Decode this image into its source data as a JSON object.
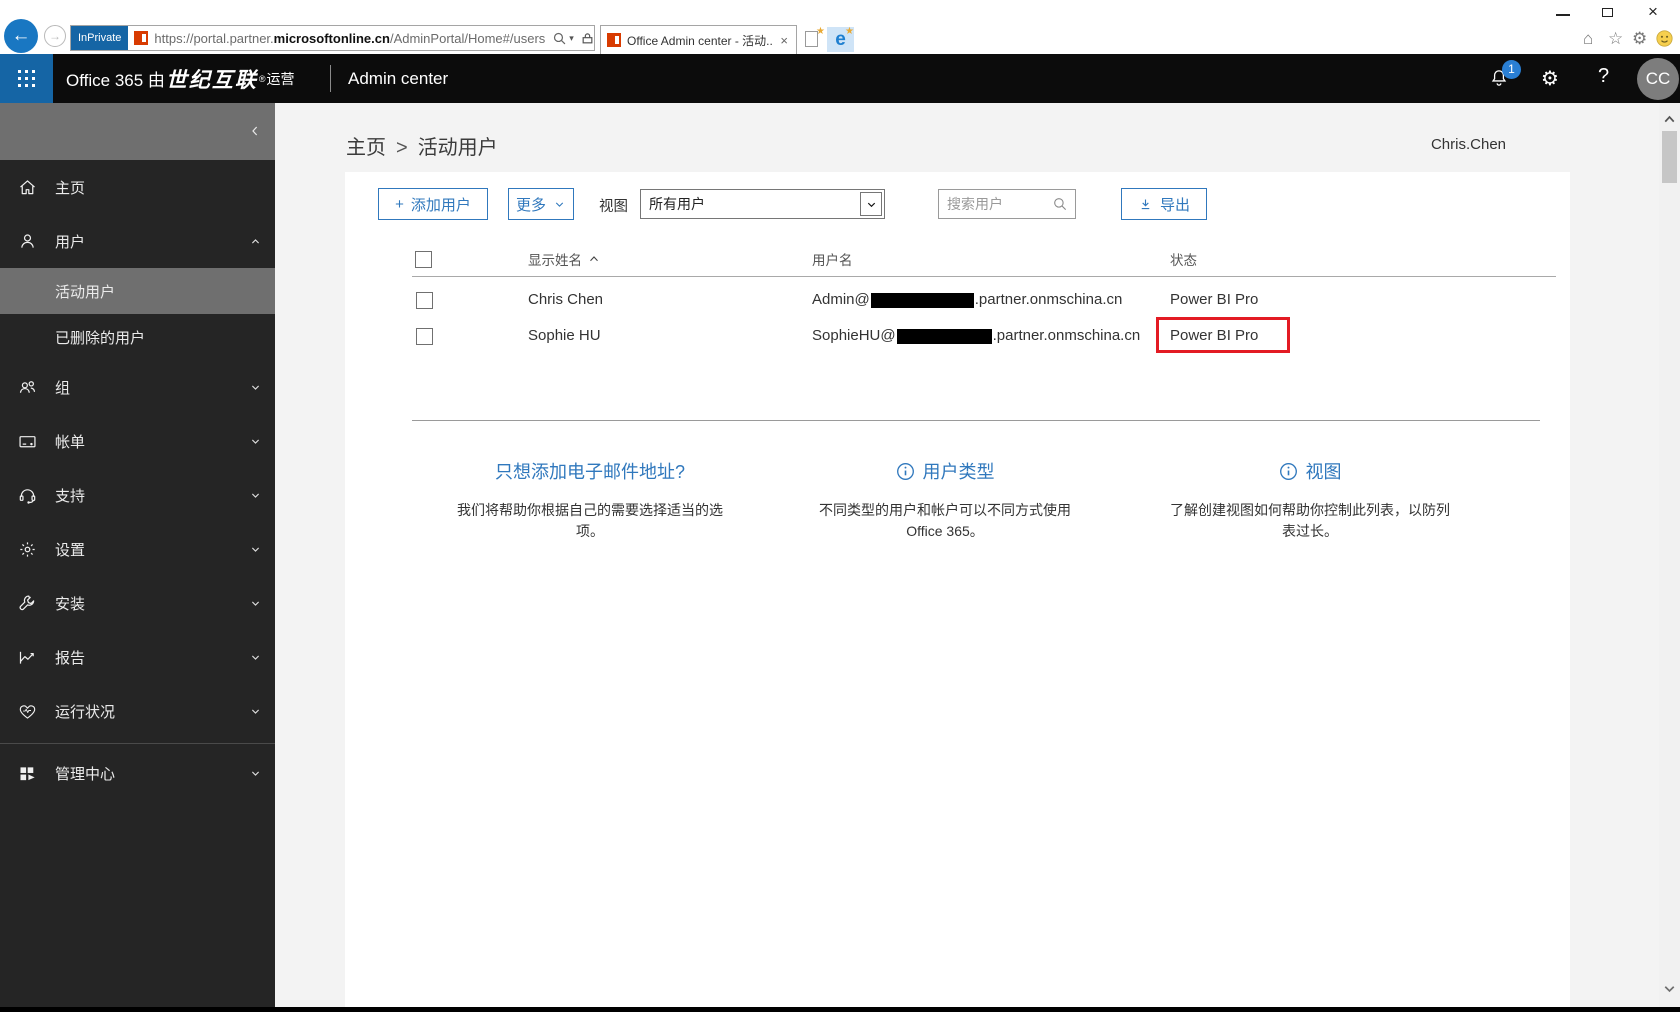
{
  "browser": {
    "inprivate_label": "InPrivate",
    "url_prefix": "https://portal.partner.",
    "url_domain": "microsoftonline.cn",
    "url_path": "/AdminPortal/Home#/users",
    "tab_title": "Office Admin center - 活动...",
    "edge_letter": "e"
  },
  "icons": {
    "back": "←",
    "forward": "→",
    "close": "×",
    "window_close": "×",
    "ie_home": "⌂",
    "ie_star": "☆",
    "ie_gear": "⚙",
    "suite_gear": "⚙",
    "help": "?",
    "url_caret": "▾",
    "newtab_star": "★",
    "plus": "+",
    "breadcrumb_sep": ">"
  },
  "suite_bar": {
    "product": "Office 365 由",
    "operator": "世纪互联",
    "reg": "®",
    "operated": "运营",
    "app_title": "Admin center",
    "notification_count": "1",
    "avatar_initials": "CC"
  },
  "sidebar": {
    "home": "主页",
    "users": "用户",
    "active_users": "活动用户",
    "deleted_users": "已删除的用户",
    "groups": "组",
    "billing": "帐单",
    "support": "支持",
    "settings": "设置",
    "setup": "安装",
    "reports": "报告",
    "health": "运行状况",
    "admin_centers": "管理中心"
  },
  "content": {
    "breadcrumb_home": "主页",
    "breadcrumb_current": "活动用户",
    "account_name": "Chris.Chen",
    "toolbar": {
      "add_user": "添加用户",
      "more": "更多",
      "view_label": "视图",
      "view_value": "所有用户",
      "search_placeholder": "搜索用户",
      "export": "导出"
    },
    "table": {
      "col_name": "显示姓名",
      "col_username": "用户名",
      "col_status": "状态",
      "rows": [
        {
          "name": "Chris Chen",
          "user_prefix": "Admin@",
          "user_suffix": ".partner.onmschina.cn",
          "status": "Power BI Pro"
        },
        {
          "name": "Sophie HU",
          "user_prefix": "SophieHU@",
          "user_suffix": ".partner.onmschina.cn",
          "status": "Power BI Pro"
        }
      ]
    },
    "cards": [
      {
        "title": "只想添加电子邮件地址?",
        "body": "我们将帮助你根据自己的需要选择适当的选项。"
      },
      {
        "title": "用户类型",
        "body": "不同类型的用户和帐户可以不同方式使用 Office 365。"
      },
      {
        "title": "视图",
        "body": "了解创建视图如何帮助你控制此列表，以防列表过长。"
      }
    ]
  },
  "colors": {
    "accent_blue": "#3078bd",
    "annotation_red": "#e31b23",
    "suite_bar_bg": "#0c0c0c",
    "waffle_blue": "#1565a5",
    "sidebar_bg": "#252525",
    "sidebar_active_bg": "#6f6f6f",
    "redaction": "#000000"
  }
}
